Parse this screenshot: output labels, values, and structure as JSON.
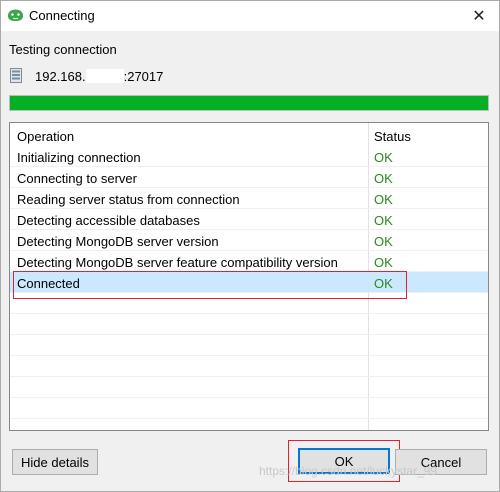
{
  "window": {
    "title": "Connecting",
    "icon": "mongodb-leaf-icon",
    "close_label": "✕"
  },
  "heading": "Testing connection",
  "server": {
    "ip_prefix": "192.168.",
    "ip_suffix": ":27017",
    "icon": "server-icon"
  },
  "progress": {
    "value": 1.0,
    "color": "#06b025"
  },
  "table": {
    "columns": [
      "Operation",
      "Status"
    ],
    "rows": [
      {
        "operation": "Initializing connection",
        "status": "OK"
      },
      {
        "operation": "Connecting to server",
        "status": "OK"
      },
      {
        "operation": "Reading server status from connection",
        "status": "OK"
      },
      {
        "operation": "Detecting accessible databases",
        "status": "OK"
      },
      {
        "operation": "Detecting MongoDB server version",
        "status": "OK"
      },
      {
        "operation": "Detecting MongoDB server feature compatibility version",
        "status": "OK"
      },
      {
        "operation": "Connected",
        "status": "OK",
        "selected": true
      }
    ],
    "status_color": "#2a8a1e",
    "selected_row_color": "#cce8ff"
  },
  "buttons": {
    "hide_details": "Hide details",
    "ok": "OK",
    "cancel": "Cancel"
  },
  "watermark": "https://blog.csdn.net/luckystar_99",
  "colors": {
    "annotation_red": "#e0222e",
    "focus_blue": "#0078d7"
  }
}
